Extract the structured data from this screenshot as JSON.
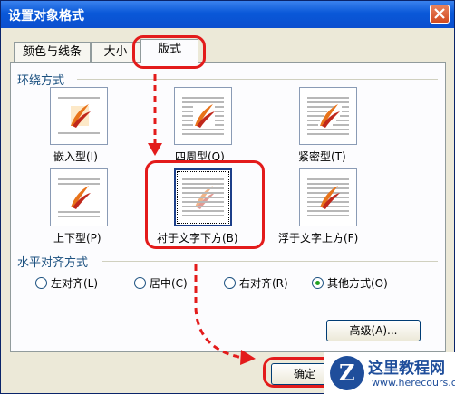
{
  "dialog": {
    "title": "设置对象格式"
  },
  "tabs": [
    {
      "label": "颜色与线条"
    },
    {
      "label": "大小"
    },
    {
      "label": "版式"
    }
  ],
  "wrap_section": {
    "heading": "环绕方式",
    "options": [
      {
        "label": "嵌入型(I)"
      },
      {
        "label": "四周型(Q)"
      },
      {
        "label": "紧密型(T)"
      },
      {
        "label": "上下型(P)"
      },
      {
        "label": "衬于文字下方(B)"
      },
      {
        "label": "浮于文字上方(F)"
      }
    ]
  },
  "align_section": {
    "heading": "水平对齐方式",
    "options": [
      {
        "label": "左对齐(L)",
        "checked": false
      },
      {
        "label": "居中(C)",
        "checked": false
      },
      {
        "label": "右对齐(R)",
        "checked": false
      },
      {
        "label": "其他方式(O)",
        "checked": true
      }
    ]
  },
  "buttons": {
    "advanced": "高级(A)...",
    "ok": "确定"
  },
  "watermark": {
    "name": "这里教程网",
    "url": "www.herecours.com",
    "logo_letter": "Z"
  },
  "colors": {
    "annotation": "#e31b1b",
    "title_bar": "#0b4fcf",
    "dialog_bg": "#ece9d8"
  }
}
